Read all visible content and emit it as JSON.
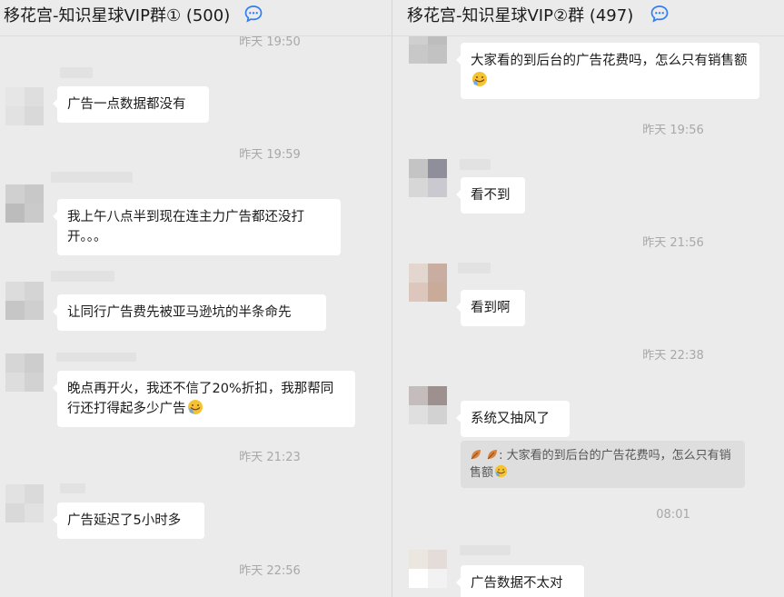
{
  "left_chat": {
    "title": "移花宫-知识星球VIP群① (500)",
    "timestamps": [
      "昨天 19:50",
      "昨天 19:59",
      "昨天 21:23",
      "昨天 22:56"
    ],
    "messages": [
      {
        "text": "广告一点数据都没有"
      },
      {
        "text": "我上午八点半到现在连主力广告都还没打开。。。"
      },
      {
        "text": "让同行广告费先被亚马逊坑的半条命先"
      },
      {
        "text": "晚点再开火，我还不信了20%折扣，我那帮同行还打得起多少广告"
      },
      {
        "text": "广告延迟了5小时多"
      }
    ]
  },
  "right_chat": {
    "title": "移花宫-知识星球VIP②群 (497)",
    "timestamps": [
      "昨天 19:56",
      "昨天 21:56",
      "昨天 22:38",
      "08:01"
    ],
    "messages": [
      {
        "text": "大家看的到后台的广告花费吗，怎么只有销售额"
      },
      {
        "text": "看不到"
      },
      {
        "text": "看到啊"
      },
      {
        "text": "系统又抽风了"
      },
      {
        "text": "广告数据不太对"
      }
    ],
    "quote": {
      "text": ": 大家看的到后台的广告花费吗，怎么只有销售额"
    }
  },
  "icons": {
    "chat_status": "chat-bubble-dots-icon",
    "emoji_facepalm": "facepalm-emoji",
    "emoji_leaf": "leaf-emoji"
  },
  "colors": {
    "background": "#ebebeb",
    "bubble": "#ffffff",
    "quote": "#dedede",
    "timestamp": "#a8a8a8",
    "icon_blue": "#2f7df6"
  }
}
